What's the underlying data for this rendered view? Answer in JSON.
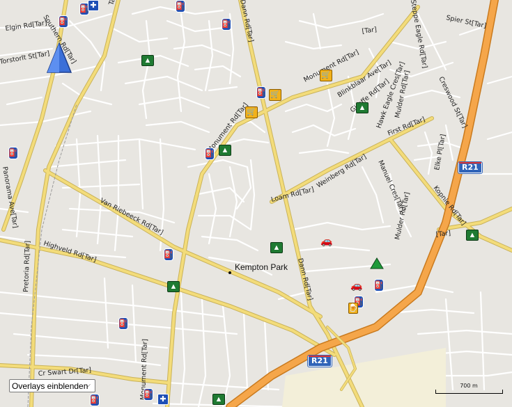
{
  "map": {
    "place_label": "Kempton Park",
    "route_shield": "R21",
    "scale_text": "700 m",
    "road_labels": [
      "Elgin Rd[Tar]",
      "Southern Rd[Tar]",
      "Torstorlt St[Tar]",
      "Panorama Ave[Tar]",
      "Pretoria Rd[Tar]",
      "Van Riebeeck Rd[Tar]",
      "Highveld Rd[Tar]",
      "Monument Rd[Tar]",
      "Monument Rd[Tar]",
      "Monument Rd[Tar]",
      "Dann Rd[Tar]",
      "Dann Rd[Tar]",
      "Loam Rd[Tar]",
      "Weinberg Rd[Tar]",
      "Blinkblaar Ave[Tar]",
      "Hawk Eagle Cres[Tar]",
      "Mulder Rd[Tar]",
      "Mulder Rd[Tar]",
      "Steppe Eagle Rd[Tar]",
      "Spier St[Tar]",
      "Creswood St[Tar]",
      "First Rd[Tar]",
      "Elke Pl[Tar]",
      "Kopnie Rd[Tar]",
      "Manuel Cres[Tar]",
      "Cr Swart Dr[Tar]",
      "Tar]",
      "[Tar]",
      "[Tar]",
      "Giraffe Rd[Tar]"
    ]
  },
  "controls": {
    "overlay_dropdown": "Overlays einblenden",
    "dropdown_chevron": "⌵"
  },
  "icons": {
    "fuel": "⛽",
    "shop": "🛒",
    "park": "▲",
    "hospital": "✚",
    "car": "🚗",
    "beer": "🍺"
  },
  "colors": {
    "motorway": "#f5a64a",
    "primary_road": "#f3dc7a",
    "minor_road": "#ffffff",
    "background": "#e8e6e1",
    "nav_arrow": "#3b6fd8"
  }
}
